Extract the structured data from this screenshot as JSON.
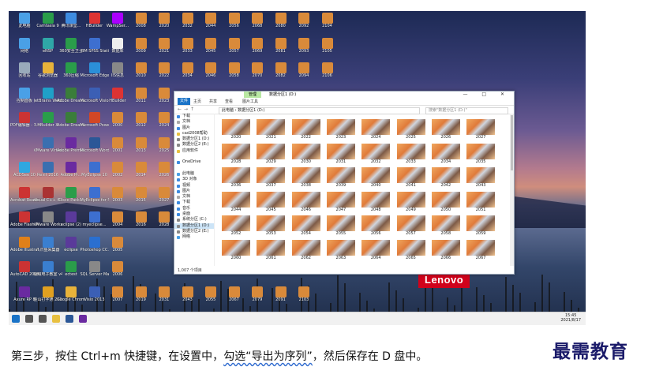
{
  "desktop": {
    "brand": "Lenovo",
    "accent": "#d0021b",
    "icons": [
      {
        "label": "此电脑",
        "color": "#4aa0e6"
      },
      {
        "label": "Camtasia 9",
        "color": "#2a9d4a"
      },
      {
        "label": "腾讯课堂...",
        "color": "#3d8be0"
      },
      {
        "label": "HBuilder",
        "color": "#d33"
      },
      {
        "label": "WampSer...",
        "color": "#a0f"
      },
      {
        "label": "2008",
        "color": "#d98a3a"
      },
      {
        "label": "2020",
        "color": "#d98a3a"
      },
      {
        "label": "2032",
        "color": "#d98a3a"
      },
      {
        "label": "2044",
        "color": "#d98a3a"
      },
      {
        "label": "2056",
        "color": "#d98a3a"
      },
      {
        "label": "2068",
        "color": "#d98a3a"
      },
      {
        "label": "2080",
        "color": "#d98a3a"
      },
      {
        "label": "2092",
        "color": "#d98a3a"
      },
      {
        "label": "2104",
        "color": "#d98a3a"
      },
      {
        "label": "网络",
        "color": "#4aa0e6"
      },
      {
        "label": "eNSP",
        "color": "#2fa7a7"
      },
      {
        "label": "360安全卫士",
        "color": "#2a9d4a"
      },
      {
        "label": "IBM SPSS Statistics 20",
        "color": "#3d6fd0"
      },
      {
        "label": "数据库",
        "color": "#eee"
      },
      {
        "label": "2009",
        "color": "#d98a3a"
      },
      {
        "label": "2021",
        "color": "#d98a3a"
      },
      {
        "label": "2033",
        "color": "#d98a3a"
      },
      {
        "label": "2045",
        "color": "#d98a3a"
      },
      {
        "label": "2057",
        "color": "#d98a3a"
      },
      {
        "label": "2069",
        "color": "#d98a3a"
      },
      {
        "label": "2081",
        "color": "#d98a3a"
      },
      {
        "label": "2093",
        "color": "#d98a3a"
      },
      {
        "label": "2105",
        "color": "#d98a3a"
      },
      {
        "label": "回收站",
        "color": "#9ab"
      },
      {
        "label": "谷歌浏览器",
        "color": "#e8b33a"
      },
      {
        "label": "360压缩",
        "color": "#2a9d4a"
      },
      {
        "label": "Microsoft Edge",
        "color": "#2b8fd8"
      },
      {
        "label": "IIS信息",
        "color": "#888"
      },
      {
        "label": "2010",
        "color": "#d98a3a"
      },
      {
        "label": "2022",
        "color": "#d98a3a"
      },
      {
        "label": "2034",
        "color": "#d98a3a"
      },
      {
        "label": "2046",
        "color": "#d98a3a"
      },
      {
        "label": "2058",
        "color": "#d98a3a"
      },
      {
        "label": "2070",
        "color": "#d98a3a"
      },
      {
        "label": "2082",
        "color": "#d98a3a"
      },
      {
        "label": "2094",
        "color": "#d98a3a"
      },
      {
        "label": "2106",
        "color": "#d98a3a"
      },
      {
        "label": "控制面板",
        "color": "#4aa0e6"
      },
      {
        "label": "JetBrains WebStor...",
        "color": "#1fa0c8"
      },
      {
        "label": "Adobe Dreamwe...",
        "color": "#3a7d3a"
      },
      {
        "label": "Microsoft Visio 2013",
        "color": "#3b5fb5"
      },
      {
        "label": "HBuilder",
        "color": "#d33"
      },
      {
        "label": "2011",
        "color": "#d98a3a"
      },
      {
        "label": "2023",
        "color": "#d98a3a"
      },
      {
        "label": "PDF编辑器 - 3.0.0 x32",
        "color": "#c33"
      },
      {
        "label": "HBuilder X",
        "color": "#2a9d4a"
      },
      {
        "label": "Adobe Dreamwe...",
        "color": "#3a7d3a"
      },
      {
        "label": "Microsoft PowerPoint...",
        "color": "#d24726"
      },
      {
        "label": "2000",
        "color": "#d98a3a"
      },
      {
        "label": "2012",
        "color": "#d98a3a"
      },
      {
        "label": "2024",
        "color": "#d98a3a"
      },
      {
        "label": "VMware Virtual Box",
        "color": "#3a6fb0"
      },
      {
        "label": "Adobe Premie...",
        "color": "#6a2aa0"
      },
      {
        "label": "Microsoft Word 2010",
        "color": "#2b5797"
      },
      {
        "label": "2001",
        "color": "#d98a3a"
      },
      {
        "label": "2013",
        "color": "#d98a3a"
      },
      {
        "label": "2025",
        "color": "#d98a3a"
      },
      {
        "label": "ACDSee 10",
        "color": "#2fa7e0"
      },
      {
        "label": "Revit 2016",
        "color": "#3a6fb0"
      },
      {
        "label": "Adobe Pr...",
        "color": "#6a2aa0"
      },
      {
        "label": "MyEclipse 10",
        "color": "#3d6fd0"
      },
      {
        "label": "2002",
        "color": "#d98a3a"
      },
      {
        "label": "2014",
        "color": "#d98a3a"
      },
      {
        "label": "2026",
        "color": "#d98a3a"
      },
      {
        "label": "Acrobat Reader DC",
        "color": "#c33"
      },
      {
        "label": "Visual C++ 6.0",
        "color": "#a33"
      },
      {
        "label": "Cisco Pack...",
        "color": "#2a9d4a"
      },
      {
        "label": "MyEclipse for Spri...",
        "color": "#3d6fd0"
      },
      {
        "label": "2003",
        "color": "#d98a3a"
      },
      {
        "label": "2015",
        "color": "#d98a3a"
      },
      {
        "label": "2027",
        "color": "#d98a3a"
      },
      {
        "label": "Adobe Flash Profession...",
        "color": "#c33"
      },
      {
        "label": "VMware Workstati...",
        "color": "#888"
      },
      {
        "label": "eclipse (2)",
        "color": "#5a3a9a"
      },
      {
        "label": "myeclipse...",
        "color": "#3d6fd0"
      },
      {
        "label": "2004",
        "color": "#d98a3a"
      },
      {
        "label": "2016",
        "color": "#d98a3a"
      },
      {
        "label": "2028",
        "color": "#d98a3a"
      },
      {
        "label": "Adobe Illustrat...",
        "color": "#e0801a"
      },
      {
        "label": "八爪鱼采集器",
        "color": "#3a7fd0"
      },
      {
        "label": "eclipse",
        "color": "#5a3a9a"
      },
      {
        "label": "Photoshop CC...",
        "color": "#2a6fd0"
      },
      {
        "label": "2005",
        "color": "#d98a3a"
      },
      {
        "label": "AutoCAD 2008 - 简体...",
        "color": "#c33"
      },
      {
        "label": "极域电子教室 v4.0 2...",
        "color": "#3a7fd0"
      },
      {
        "label": "ectest",
        "color": "#2a9d4a"
      },
      {
        "label": "SQL Server Manage...",
        "color": "#888"
      },
      {
        "label": "2006",
        "color": "#d98a3a"
      },
      {
        "label": "Axure RP 8",
        "color": "#6a2aa0"
      },
      {
        "label": "金山打字通 2010",
        "color": "#e0a020"
      },
      {
        "label": "Google Chrome",
        "color": "#e8b33a"
      },
      {
        "label": "Visio 2013",
        "color": "#3b5fb5"
      },
      {
        "label": "2007",
        "color": "#d98a3a"
      },
      {
        "label": "2019",
        "color": "#d98a3a"
      },
      {
        "label": "2031",
        "color": "#d98a3a"
      },
      {
        "label": "2043",
        "color": "#d98a3a"
      },
      {
        "label": "2055",
        "color": "#d98a3a"
      },
      {
        "label": "2067",
        "color": "#d98a3a"
      },
      {
        "label": "2079",
        "color": "#d98a3a"
      },
      {
        "label": "2091",
        "color": "#d98a3a"
      },
      {
        "label": "2103",
        "color": "#d98a3a"
      }
    ]
  },
  "explorer": {
    "title": "数据分区1 (D:)",
    "manage_tab": "管理",
    "ribbon_tabs": [
      "文件",
      "主页",
      "共享",
      "查看",
      "图片工具"
    ],
    "window_buttons": "— □ ✕",
    "address": "此电脑 › 数据分区1 (D:)",
    "search_placeholder": "搜索\"数据分区1 (D:)\"",
    "nav_items": [
      {
        "label": "下载",
        "color": "#3d8be0"
      },
      {
        "label": "文档",
        "color": "#aaa"
      },
      {
        "label": "图片",
        "color": "#3d8be0"
      },
      {
        "label": "cad2008帮助",
        "color": "#e8c040"
      },
      {
        "label": "数据分区1 (D:)",
        "color": "#888"
      },
      {
        "label": "数据分区2 (E:)",
        "color": "#888"
      },
      {
        "label": "应用软件",
        "color": "#e8c040"
      },
      {
        "label": "",
        "color": "transparent"
      },
      {
        "label": "OneDrive",
        "color": "#3d8be0"
      },
      {
        "label": "",
        "color": "transparent"
      },
      {
        "label": "此电脑",
        "color": "#4aa0e6"
      },
      {
        "label": "3D 对象",
        "color": "#3d8be0"
      },
      {
        "label": "视频",
        "color": "#3d8be0"
      },
      {
        "label": "图片",
        "color": "#3d8be0"
      },
      {
        "label": "文档",
        "color": "#aaa"
      },
      {
        "label": "下载",
        "color": "#3d8be0"
      },
      {
        "label": "音乐",
        "color": "#3d8be0"
      },
      {
        "label": "桌面",
        "color": "#3d8be0"
      },
      {
        "label": "系统分区 (C:)",
        "color": "#888"
      },
      {
        "label": "数据分区1 (D:)",
        "color": "#888",
        "selected": true
      },
      {
        "label": "数据分区2 (E:)",
        "color": "#888"
      },
      {
        "label": "网络",
        "color": "#4aa0e6"
      }
    ],
    "files": [
      "2020",
      "2021",
      "2022",
      "2023",
      "2024",
      "2025",
      "2026",
      "2027",
      "2028",
      "2029",
      "2030",
      "2031",
      "2032",
      "2033",
      "2034",
      "2035",
      "2036",
      "2037",
      "2038",
      "2039",
      "2040",
      "2041",
      "2042",
      "2043",
      "2044",
      "2045",
      "2046",
      "2047",
      "2048",
      "2049",
      "2050",
      "2051",
      "2052",
      "2053",
      "2054",
      "2055",
      "2056",
      "2057",
      "2058",
      "2059",
      "2060",
      "2061",
      "2062",
      "2063",
      "2064",
      "2065",
      "2066",
      "2067"
    ],
    "status": "1,007 个项目"
  },
  "taskbar": {
    "items": [
      {
        "name": "start-icon",
        "color": "#1a73c7"
      },
      {
        "name": "search-icon",
        "color": "#555"
      },
      {
        "name": "task-view-icon",
        "color": "#555"
      },
      {
        "name": "explorer-icon",
        "color": "#e8c040"
      },
      {
        "name": "word-icon",
        "color": "#2b5797"
      },
      {
        "name": "premiere-icon",
        "color": "#6a2aa0"
      }
    ],
    "time": "15:45",
    "date": "2021/8/17"
  },
  "caption": {
    "part1": "第三步，按住 Ctrl+m 快捷键，在设置中，",
    "underlined": "勾选“导出为序列”",
    "part2": "，然后保存在 D 盘中。",
    "watermark": "最需教育"
  }
}
